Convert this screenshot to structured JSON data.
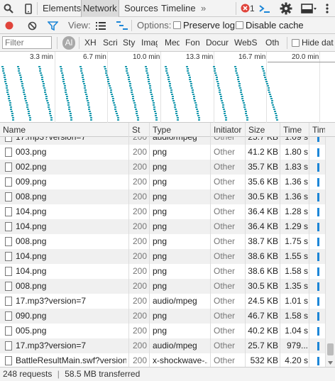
{
  "topbar": {
    "icons": [
      "search-icon",
      "device-mode-icon",
      "console-icon",
      "gear-icon",
      "dock-icon",
      "more-icon"
    ],
    "tabs": [
      "Elements",
      "Network",
      "Sources",
      "Timeline"
    ],
    "more_label": "»",
    "error_count": "1"
  },
  "toolbar": {
    "view_label": "View:",
    "options_label": "Options:",
    "preserve_log": "Preserve log",
    "disable_cache": "Disable cache"
  },
  "filter": {
    "placeholder": "Filter",
    "all_label": "Al",
    "types": [
      "XH",
      "Scri",
      "Sty",
      "Imag",
      "Med",
      "Fon",
      "Docur",
      "WebS",
      "Oth"
    ],
    "hide_data": "Hide dat"
  },
  "overview": {
    "ticks": [
      "3.3 min",
      "6.7 min",
      "10.0 min",
      "13.3 min",
      "16.7 min",
      "20.0 min"
    ]
  },
  "columns": [
    "Name",
    "St",
    "Type",
    "Initiator",
    "Size",
    "Time",
    "Tim"
  ],
  "rows": [
    {
      "name": "17.mp3?version=7",
      "status": "200",
      "type": "audio/mpeg",
      "initiator": "Other",
      "size": "25.7 KB",
      "time": "1.09 s"
    },
    {
      "name": "003.png",
      "status": "200",
      "type": "png",
      "initiator": "Other",
      "size": "41.2 KB",
      "time": "1.80 s"
    },
    {
      "name": "002.png",
      "status": "200",
      "type": "png",
      "initiator": "Other",
      "size": "35.7 KB",
      "time": "1.83 s"
    },
    {
      "name": "009.png",
      "status": "200",
      "type": "png",
      "initiator": "Other",
      "size": "35.6 KB",
      "time": "1.36 s"
    },
    {
      "name": "008.png",
      "status": "200",
      "type": "png",
      "initiator": "Other",
      "size": "30.5 KB",
      "time": "1.36 s"
    },
    {
      "name": "104.png",
      "status": "200",
      "type": "png",
      "initiator": "Other",
      "size": "36.4 KB",
      "time": "1.28 s"
    },
    {
      "name": "104.png",
      "status": "200",
      "type": "png",
      "initiator": "Other",
      "size": "36.4 KB",
      "time": "1.29 s"
    },
    {
      "name": "008.png",
      "status": "200",
      "type": "png",
      "initiator": "Other",
      "size": "38.7 KB",
      "time": "1.75 s"
    },
    {
      "name": "104.png",
      "status": "200",
      "type": "png",
      "initiator": "Other",
      "size": "38.6 KB",
      "time": "1.55 s"
    },
    {
      "name": "104.png",
      "status": "200",
      "type": "png",
      "initiator": "Other",
      "size": "38.6 KB",
      "time": "1.58 s"
    },
    {
      "name": "008.png",
      "status": "200",
      "type": "png",
      "initiator": "Other",
      "size": "30.5 KB",
      "time": "1.35 s"
    },
    {
      "name": "17.mp3?version=7",
      "status": "200",
      "type": "audio/mpeg",
      "initiator": "Other",
      "size": "24.5 KB",
      "time": "1.01 s"
    },
    {
      "name": "090.png",
      "status": "200",
      "type": "png",
      "initiator": "Other",
      "size": "46.7 KB",
      "time": "1.58 s"
    },
    {
      "name": "005.png",
      "status": "200",
      "type": "png",
      "initiator": "Other",
      "size": "40.2 KB",
      "time": "1.04 s"
    },
    {
      "name": "17.mp3?version=7",
      "status": "200",
      "type": "audio/mpeg",
      "initiator": "Other",
      "size": "25.7 KB",
      "time": "979..."
    },
    {
      "name": "BattleResultMain.swf?version...",
      "status": "200",
      "type": "x-shockwave-...",
      "initiator": "Other",
      "size": "532 KB",
      "time": "4.20 s"
    }
  ],
  "status": {
    "requests": "248 requests",
    "separator": "|",
    "transferred": "58.5 MB transferred"
  },
  "colors": {
    "record": "#e0443b",
    "accent": "#1c86d7",
    "error": "#e0443b",
    "overview_bar": "#1e9bb0"
  }
}
